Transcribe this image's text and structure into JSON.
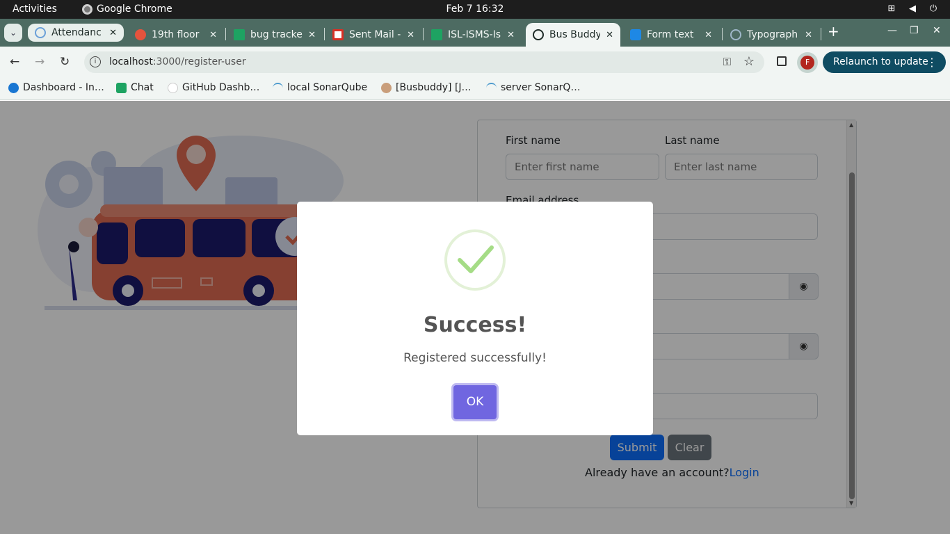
{
  "system_bar": {
    "activities": "Activities",
    "app_name": "Google Chrome",
    "clock": "Feb 7  16:32"
  },
  "tabs": [
    {
      "title": "Attendanc",
      "favicon_color": "#6aa0d8",
      "state": "pill"
    },
    {
      "title": "19th floor",
      "favicon_color": "#e5533d",
      "state": "inactive"
    },
    {
      "title": "bug tracke",
      "favicon_color": "#1ea362",
      "state": "inactive"
    },
    {
      "title": "Sent Mail -",
      "favicon_color": "#d93025",
      "state": "inactive"
    },
    {
      "title": "ISL-ISMS-Is",
      "favicon_color": "#1ea362",
      "state": "inactive"
    },
    {
      "title": "Bus Buddy",
      "favicon_color": "#1d2a26",
      "state": "active"
    },
    {
      "title": "Form text",
      "favicon_color": "#1e88e5",
      "state": "inactive"
    },
    {
      "title": "Typograph",
      "favicon_color": "#9fb7c9",
      "state": "inactive"
    }
  ],
  "toolbar": {
    "url_host": "localhost",
    "url_path": ":3000/register-user",
    "profile_initial": "F",
    "relaunch_label": "Relaunch to update"
  },
  "bookmarks": [
    {
      "label": "Dashboard - In…",
      "color": "#1976d2"
    },
    {
      "label": "Chat",
      "color": "#1ea362"
    },
    {
      "label": "GitHub Dashb…",
      "color": "#ffffff"
    },
    {
      "label": "local SonarQube",
      "color": "#4e9bcd"
    },
    {
      "label": "[Busbuddy] [J…",
      "color": "#c99e7b"
    },
    {
      "label": "server SonarQ…",
      "color": "#4e9bcd"
    }
  ],
  "form": {
    "first_name_label": "First name",
    "first_name_placeholder": "Enter first name",
    "last_name_label": "Last name",
    "last_name_placeholder": "Enter last name",
    "email_label": "Email address",
    "submit_label": "Submit",
    "clear_label": "Clear",
    "login_prompt": "Already have an account?",
    "login_link": "Login"
  },
  "modal": {
    "title": "Success!",
    "message": "Registered successfully!",
    "ok_label": "OK",
    "accent": "#7066e0",
    "check_color": "#a5dc86"
  }
}
